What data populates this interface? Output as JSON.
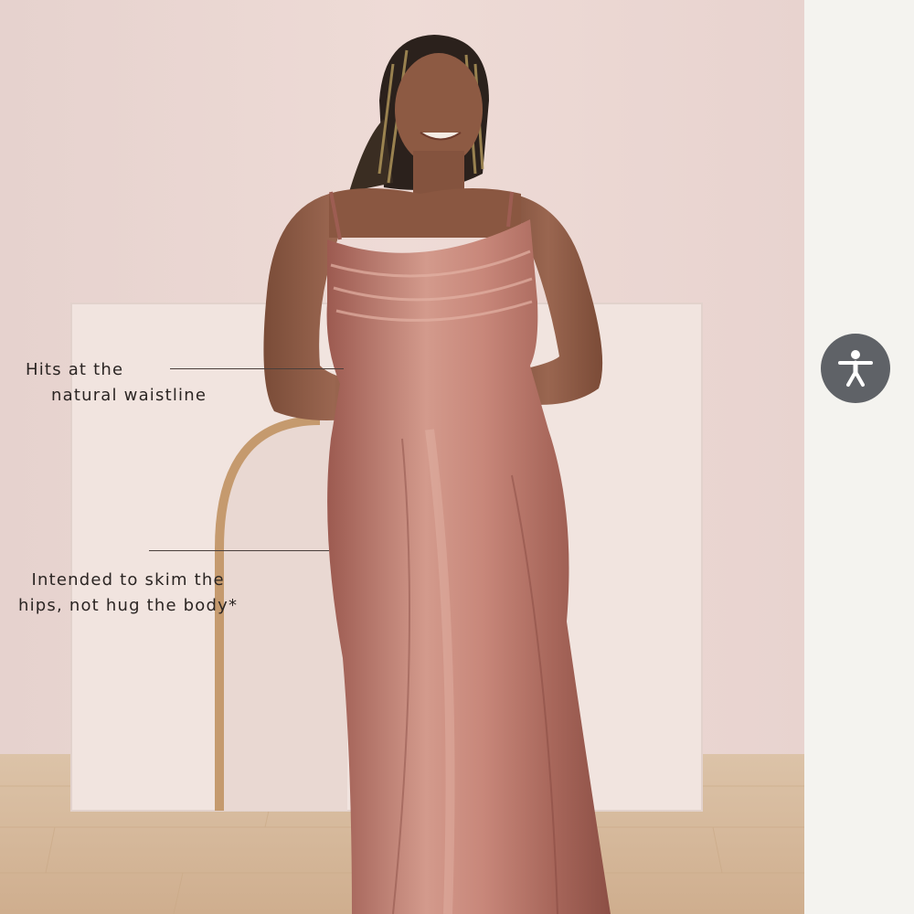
{
  "annotations": {
    "waist": {
      "line1": "Hits at the",
      "line2": "natural waistline"
    },
    "hips": {
      "line1": "Intended to skim the",
      "line2": "hips, not hug the body*"
    }
  },
  "accessibility": {
    "icon": "accessibility-person-icon",
    "button_color": "#5f6267"
  },
  "colors": {
    "wall": "#ead6d2",
    "floor": "#d9bfa3",
    "dress": "#c07f74",
    "skin": "#8a5a44",
    "panel": "#f4f3ef"
  }
}
